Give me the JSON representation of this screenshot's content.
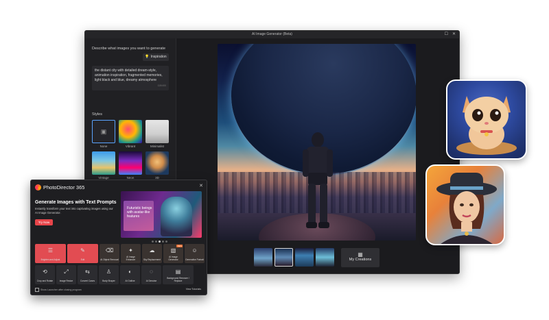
{
  "ai_window": {
    "title": "AI Image Generator (Beta)",
    "prompt_label": "Describe what images you want to generate",
    "inspiration_label": "Inspiration",
    "prompt_text": "the distant city with detailed dream-style, animation inspiration, fragmented memories, light black and blue, dreamy atmosphere",
    "prompt_count": "115/400",
    "styles_label": "Styles",
    "styles": [
      {
        "label": "None",
        "icon": "image-icon"
      },
      {
        "label": "Vibrant"
      },
      {
        "label": "Minimalist"
      },
      {
        "label": "Vintage"
      },
      {
        "label": "Neon"
      },
      {
        "label": "3D"
      }
    ],
    "my_creations_label": "My Creations"
  },
  "pd_window": {
    "app_name": "PhotoDirector 365",
    "headline": "Generate Images with Text Prompts",
    "description": "Instantly transform your text into captivating images using our AI Image Generator.",
    "try_label": "Try Now",
    "banner_text": "Futuristic beings with avatar-like features",
    "tools_row1": [
      {
        "label": "Brighten and Adjust",
        "icon": "sliders-icon"
      },
      {
        "label": "Edit",
        "icon": "edit-icon"
      },
      {
        "label": "AI Object Removal",
        "icon": "eraser-icon"
      },
      {
        "label": "AI Image Enhancer",
        "icon": "enhance-icon"
      },
      {
        "label": "Sky Replacement",
        "icon": "sky-icon"
      },
      {
        "label": "AI Image Generator",
        "icon": "ai-image-icon",
        "badge": "NEW"
      },
      {
        "label": "Generative Portrait",
        "icon": "portrait-icon"
      }
    ],
    "tools_row2": [
      {
        "label": "Crop and Rotate",
        "icon": "crop-icon"
      },
      {
        "label": "Image Resize",
        "icon": "resize-icon"
      },
      {
        "label": "Convert Cases",
        "icon": "convert-icon"
      },
      {
        "label": "Body Shaper",
        "icon": "body-icon"
      },
      {
        "label": "AI Outline",
        "icon": "outline-icon"
      },
      {
        "label": "AI Denoise",
        "icon": "denoise-icon"
      },
      {
        "label": "Background Remover / Replace",
        "icon": "background-icon"
      }
    ],
    "footer_checkbox": "Show Launcher after closing program",
    "tutorials_link": "View Tutorials"
  }
}
